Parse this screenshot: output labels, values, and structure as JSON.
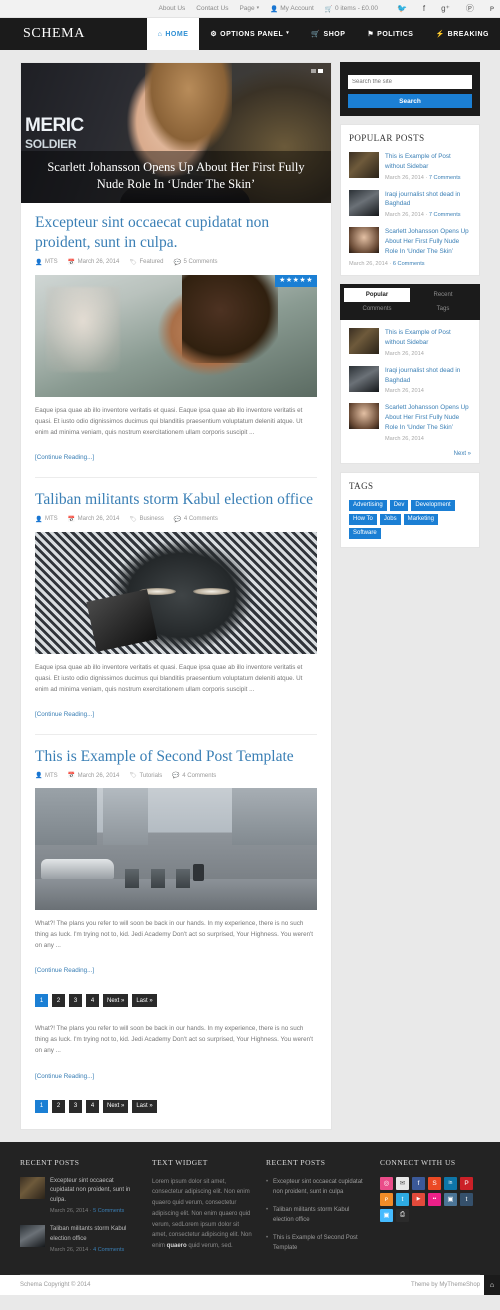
{
  "topbar": {
    "links": [
      {
        "label": "About Us",
        "icon": ""
      },
      {
        "label": "Contact Us",
        "icon": ""
      },
      {
        "label": "Page",
        "icon": "",
        "caret": true
      }
    ],
    "account_label": "My Account",
    "account_icon": "user-icon",
    "cart_label": "0 items - £0.00",
    "cart_icon": "cart-icon",
    "social": [
      "twitter-icon",
      "facebook-icon",
      "google-plus-icon",
      "pinterest-icon",
      "rss-icon"
    ],
    "social_glyphs": [
      "🐦",
      "f",
      "g+",
      "Ⓟ",
      "ᴘ"
    ]
  },
  "header": {
    "logo": "SCHEMA",
    "nav": [
      {
        "label": "HOME",
        "icon": "home-icon",
        "glyph": "⌂",
        "active": true,
        "caret": false
      },
      {
        "label": "OPTIONS PANEL",
        "icon": "gear-icon",
        "glyph": "⚙",
        "active": false,
        "caret": true
      },
      {
        "label": "SHOP",
        "icon": "cart-icon",
        "glyph": "🛒",
        "active": false,
        "caret": false
      },
      {
        "label": "POLITICS",
        "icon": "flag-icon",
        "glyph": "⚑",
        "active": false,
        "caret": false
      },
      {
        "label": "BREAKING",
        "icon": "bolt-icon",
        "glyph": "⚡",
        "active": false,
        "caret": false
      }
    ]
  },
  "slider": {
    "headline": "Scarlett Johansson Opens Up About Her First Fully Nude Role In ‘Under The Skin’",
    "overlay_line1": "MERIC",
    "overlay_line2": "SOLDIER",
    "dots": 2,
    "active_dot": 1
  },
  "posts": [
    {
      "title": "Excepteur sint occaecat cupidatat non proident, sunt in culpa.",
      "author": "MTS",
      "date": "March 26, 2014",
      "category": "Featured",
      "comments": "5 Comments",
      "rating": "★★★★★",
      "excerpt": "Eaque ipsa quae ab illo inventore veritatis et quasi. Eaque ipsa quae ab illo inventore veritatis et quasi. Et iusto odio dignissimos ducimus qui blanditiis praesentium voluptatum deleniti atque. Ut enim ad minima veniam, quis nostrum exercitationem ullam corporis suscipit ...",
      "more_label": "[Continue Reading...]",
      "thumb_class": "t1"
    },
    {
      "title": "Taliban militants storm Kabul election office",
      "author": "MTS",
      "date": "March 26, 2014",
      "category": "Business",
      "comments": "4 Comments",
      "rating": "",
      "excerpt": "Eaque ipsa quae ab illo inventore veritatis et quasi. Eaque ipsa quae ab illo inventore veritatis et quasi. Et iusto odio dignissimos ducimus qui blanditiis praesentium voluptatum deleniti atque. Ut enim ad minima veniam, quis nostrum exercitationem ullam corporis suscipit ...",
      "more_label": "[Continue Reading...]",
      "thumb_class": "t2"
    },
    {
      "title": "This is Example of Second Post Template",
      "author": "MTS",
      "date": "March 26, 2014",
      "category": "Tutorials",
      "comments": "4 Comments",
      "rating": "",
      "excerpt": "What?! The plans you refer to will soon be back in our hands. In my experience, there is no such thing as luck. I'm trying not to, kid. Jedi Academy Don't act so surprised, Your Highness. You weren't on any ...",
      "more_label": "[Continue Reading...]",
      "thumb_class": "t3"
    }
  ],
  "extra_block": {
    "excerpt": "What?! The plans you refer to will soon be back in our hands. In my experience, there is no such thing as luck. I'm trying not to, kid. Jedi Academy Don't act so surprised, Your Highness. You weren't on any ...",
    "more_label": "[Continue Reading...]"
  },
  "pagination": {
    "pages": [
      "1",
      "2",
      "3",
      "4"
    ],
    "current": "1",
    "next_label": "Next »",
    "last_label": "Last »"
  },
  "sidebar": {
    "search": {
      "placeholder": "Search the site",
      "button_label": "Search"
    },
    "popular": {
      "title": "POPULAR POSTS",
      "items": [
        {
          "title": "This is Example of Post without Sidebar",
          "date": "March 26, 2014",
          "sep": " · ",
          "comments": "7 Comments",
          "thumb": "thumbA"
        },
        {
          "title": "Iraqi journalist shot dead in Baghdad",
          "date": "March 26, 2014",
          "sep": " · ",
          "comments": "7 Comments",
          "thumb": "thumbB"
        },
        {
          "title": "Scarlett Johansson Opens Up About Her First Fully Nude Role In ‘Under The Skin’",
          "date": "March 26, 2014",
          "sep": " · ",
          "comments": "6 Comments",
          "thumb": "thumbC"
        }
      ]
    },
    "tabs": {
      "items": [
        "Popular",
        "Recent",
        "Comments",
        "Tags"
      ],
      "active": "Popular",
      "posts": [
        {
          "title": "This is Example of Post without Sidebar",
          "date": "March 26, 2014",
          "thumb": "thumbA"
        },
        {
          "title": "Iraqi journalist shot dead in Baghdad",
          "date": "March 26, 2014",
          "thumb": "thumbB"
        },
        {
          "title": "Scarlett Johansson Opens Up About Her First Fully Nude Role In ‘Under The Skin’",
          "date": "March 26, 2014",
          "thumb": "thumbC"
        }
      ],
      "next_label": "Next »"
    },
    "tags": {
      "title": "TAGS",
      "items": [
        "Advertising",
        "Dev",
        "Development",
        "How To",
        "Jobs",
        "Marketing",
        "Software"
      ]
    }
  },
  "footer": {
    "recent_posts": {
      "title": "RECENT POSTS",
      "items": [
        {
          "title": "Excepteur sint occaecat cupidatat non proident, sunt in culpa.",
          "date": "March 26, 2014",
          "sep": " · ",
          "comments": "5 Comments",
          "thumb": "thumbA"
        },
        {
          "title": "Taliban militants storm Kabul election office",
          "date": "March 26, 2014",
          "sep": " · ",
          "comments": "4 Comments",
          "thumb": "thumbB"
        }
      ]
    },
    "text_widget": {
      "title": "TEXT WIDGET",
      "body_1": "Lorem ipsum dolor sit amet, consectetur adipiscing elit. Non enim quaero quid verum, consectetur adipiscing elit. Non enim quaero quid verum, sedLorem ipsum dolor sit amet, consectetur adipiscing elit. Non enim ",
      "bold": "quaero",
      "body_2": " quid verum, sed."
    },
    "recent_list": {
      "title": "RECENT POSTS",
      "items": [
        "Excepteur sint occaecat cupidatat non proident, sunt in culpa",
        "Taliban militants storm Kabul election office",
        "This is Example of Second Post Template"
      ]
    },
    "connect": {
      "title": "CONNECT WITH US",
      "icons": [
        {
          "name": "dribbble-icon",
          "glyph": "◎",
          "color": "#ea4c89"
        },
        {
          "name": "email-icon",
          "glyph": "✉",
          "color": "#e8e8e8"
        },
        {
          "name": "facebook-icon",
          "glyph": "f",
          "color": "#3b5998"
        },
        {
          "name": "stumbleupon-icon",
          "glyph": "S",
          "color": "#eb4924"
        },
        {
          "name": "linkedin-icon",
          "glyph": "in",
          "color": "#0e76a8"
        },
        {
          "name": "pinterest-icon",
          "glyph": "P",
          "color": "#cb2027"
        },
        {
          "name": "rss-icon",
          "glyph": "ᴘ",
          "color": "#f28c28"
        },
        {
          "name": "twitter-icon",
          "glyph": "t",
          "color": "#2eaae1"
        },
        {
          "name": "youtube-icon",
          "glyph": "▶",
          "color": "#e24a3b"
        },
        {
          "name": "flickr-icon",
          "glyph": "••",
          "color": "#ec2089"
        },
        {
          "name": "instagram-icon",
          "glyph": "▣",
          "color": "#4b7496"
        },
        {
          "name": "tumblr-icon",
          "glyph": "t",
          "color": "#35506b"
        },
        {
          "name": "vimeo-icon",
          "glyph": "V",
          "color": "#45bbff"
        },
        {
          "name": "print-icon",
          "glyph": "⎙",
          "color": "#2b2b2b"
        }
      ]
    },
    "copyright": "Schema Copyright © 2014",
    "theme_credit": "Theme by MyThemeShop",
    "to_top_icon": "home-icon",
    "to_top_glyph": "⌂"
  }
}
